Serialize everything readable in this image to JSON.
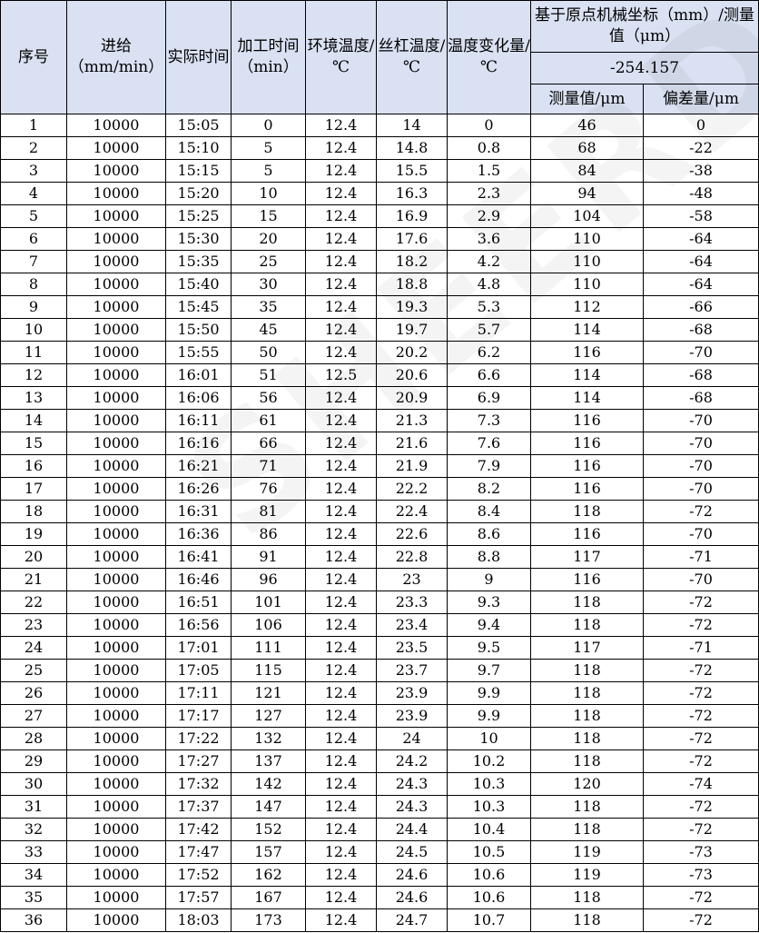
{
  "header": {
    "col_seq": "序号",
    "col_feed": "进给（mm/min）",
    "col_time": "实际时间",
    "col_elapsed": "加工时间（min）",
    "col_env_temp": "环境温度/℃",
    "col_screw_temp": "丝杠温度/℃",
    "col_temp_change": "温度变化量/℃",
    "group_title": "基于原点机械坐标（mm）/测量值（μm）",
    "group_value": "-254.157",
    "col_measured": "测量值/μm",
    "col_deviation": "偏差量/μm"
  },
  "watermark": "SHEERDATA",
  "rows": [
    [
      "1",
      "10000",
      "15:05",
      "0",
      "12.4",
      "14",
      "0",
      "46",
      "0"
    ],
    [
      "2",
      "10000",
      "15:10",
      "5",
      "12.4",
      "14.8",
      "0.8",
      "68",
      "-22"
    ],
    [
      "3",
      "10000",
      "15:15",
      "5",
      "12.4",
      "15.5",
      "1.5",
      "84",
      "-38"
    ],
    [
      "4",
      "10000",
      "15:20",
      "10",
      "12.4",
      "16.3",
      "2.3",
      "94",
      "-48"
    ],
    [
      "5",
      "10000",
      "15:25",
      "15",
      "12.4",
      "16.9",
      "2.9",
      "104",
      "-58"
    ],
    [
      "6",
      "10000",
      "15:30",
      "20",
      "12.4",
      "17.6",
      "3.6",
      "110",
      "-64"
    ],
    [
      "7",
      "10000",
      "15:35",
      "25",
      "12.4",
      "18.2",
      "4.2",
      "110",
      "-64"
    ],
    [
      "8",
      "10000",
      "15:40",
      "30",
      "12.4",
      "18.8",
      "4.8",
      "110",
      "-64"
    ],
    [
      "9",
      "10000",
      "15:45",
      "35",
      "12.4",
      "19.3",
      "5.3",
      "112",
      "-66"
    ],
    [
      "10",
      "10000",
      "15:50",
      "45",
      "12.4",
      "19.7",
      "5.7",
      "114",
      "-68"
    ],
    [
      "11",
      "10000",
      "15:55",
      "50",
      "12.4",
      "20.2",
      "6.2",
      "116",
      "-70"
    ],
    [
      "12",
      "10000",
      "16:01",
      "51",
      "12.5",
      "20.6",
      "6.6",
      "114",
      "-68"
    ],
    [
      "13",
      "10000",
      "16:06",
      "56",
      "12.4",
      "20.9",
      "6.9",
      "114",
      "-68"
    ],
    [
      "14",
      "10000",
      "16:11",
      "61",
      "12.4",
      "21.3",
      "7.3",
      "116",
      "-70"
    ],
    [
      "15",
      "10000",
      "16:16",
      "66",
      "12.4",
      "21.6",
      "7.6",
      "116",
      "-70"
    ],
    [
      "16",
      "10000",
      "16:21",
      "71",
      "12.4",
      "21.9",
      "7.9",
      "116",
      "-70"
    ],
    [
      "17",
      "10000",
      "16:26",
      "76",
      "12.4",
      "22.2",
      "8.2",
      "116",
      "-70"
    ],
    [
      "18",
      "10000",
      "16:31",
      "81",
      "12.4",
      "22.4",
      "8.4",
      "118",
      "-72"
    ],
    [
      "19",
      "10000",
      "16:36",
      "86",
      "12.4",
      "22.6",
      "8.6",
      "116",
      "-70"
    ],
    [
      "20",
      "10000",
      "16:41",
      "91",
      "12.4",
      "22.8",
      "8.8",
      "117",
      "-71"
    ],
    [
      "21",
      "10000",
      "16:46",
      "96",
      "12.4",
      "23",
      "9",
      "116",
      "-70"
    ],
    [
      "22",
      "10000",
      "16:51",
      "101",
      "12.4",
      "23.3",
      "9.3",
      "118",
      "-72"
    ],
    [
      "23",
      "10000",
      "16:56",
      "106",
      "12.4",
      "23.4",
      "9.4",
      "118",
      "-72"
    ],
    [
      "24",
      "10000",
      "17:01",
      "111",
      "12.4",
      "23.5",
      "9.5",
      "117",
      "-71"
    ],
    [
      "25",
      "10000",
      "17:05",
      "115",
      "12.4",
      "23.7",
      "9.7",
      "118",
      "-72"
    ],
    [
      "26",
      "10000",
      "17:11",
      "121",
      "12.4",
      "23.9",
      "9.9",
      "118",
      "-72"
    ],
    [
      "27",
      "10000",
      "17:17",
      "127",
      "12.4",
      "23.9",
      "9.9",
      "118",
      "-72"
    ],
    [
      "28",
      "10000",
      "17:22",
      "132",
      "12.4",
      "24",
      "10",
      "118",
      "-72"
    ],
    [
      "29",
      "10000",
      "17:27",
      "137",
      "12.4",
      "24.2",
      "10.2",
      "118",
      "-72"
    ],
    [
      "30",
      "10000",
      "17:32",
      "142",
      "12.4",
      "24.3",
      "10.3",
      "120",
      "-74"
    ],
    [
      "31",
      "10000",
      "17:37",
      "147",
      "12.4",
      "24.3",
      "10.3",
      "118",
      "-72"
    ],
    [
      "32",
      "10000",
      "17:42",
      "152",
      "12.4",
      "24.4",
      "10.4",
      "118",
      "-72"
    ],
    [
      "33",
      "10000",
      "17:47",
      "157",
      "12.4",
      "24.5",
      "10.5",
      "119",
      "-73"
    ],
    [
      "34",
      "10000",
      "17:52",
      "162",
      "12.4",
      "24.6",
      "10.6",
      "119",
      "-73"
    ],
    [
      "35",
      "10000",
      "17:57",
      "167",
      "12.4",
      "24.6",
      "10.6",
      "118",
      "-72"
    ],
    [
      "36",
      "10000",
      "18:03",
      "173",
      "12.4",
      "24.7",
      "10.7",
      "118",
      "-72"
    ]
  ]
}
